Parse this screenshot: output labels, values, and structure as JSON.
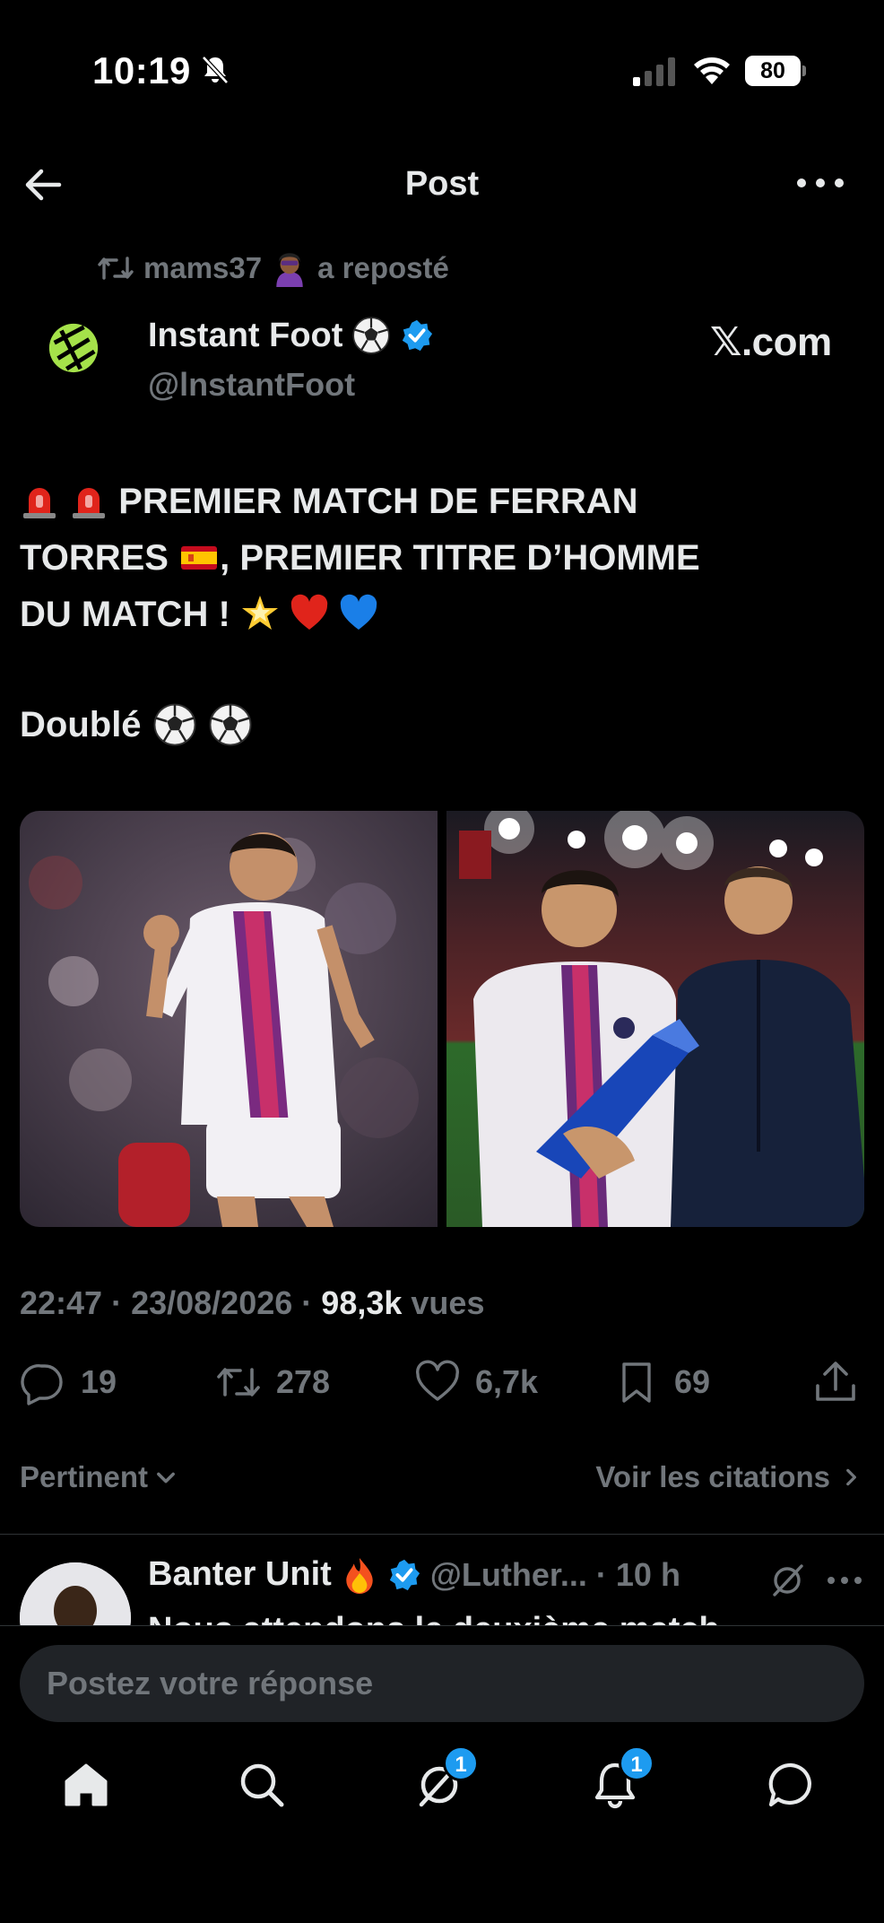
{
  "status_bar": {
    "time": "10:19",
    "battery": "80"
  },
  "header": {
    "title": "Post"
  },
  "repost": {
    "user": "mams37",
    "text": "a reposté"
  },
  "author": {
    "name": "Instant Foot",
    "handle": "@lnstantFoot",
    "source": "𝕏.com"
  },
  "tweet": {
    "line1": "PREMIER MATCH DE FERRAN",
    "line2a": "TORRES",
    "line2b": ", PREMIER TITRE D’HOMME",
    "line3": "DU MATCH !",
    "line4": "Doublé"
  },
  "media": {
    "left_alt": "player celebrating",
    "right_alt": "player receiving trophy"
  },
  "meta": {
    "time": "22:47",
    "date": "23/08/2026",
    "views": "98,3k",
    "views_label": "vues"
  },
  "actions": {
    "replies": "19",
    "reposts": "278",
    "likes": "6,7k",
    "bookmarks": "69"
  },
  "sort": {
    "left": "Pertinent",
    "right": "Voir les citations"
  },
  "reply": {
    "name": "Banter Unit",
    "handle": "@Luther...",
    "time": "· 10 h",
    "text": "Nous attendons le deuxième match"
  },
  "reply_bar": {
    "placeholder": "Postez votre réponse"
  },
  "tabbar": {
    "messages_badge": "1",
    "notifications_badge": "1"
  },
  "colors": {
    "accent": "#1d9bf0",
    "muted": "#71767b",
    "text": "#e7e9ea",
    "background": "#000000"
  }
}
